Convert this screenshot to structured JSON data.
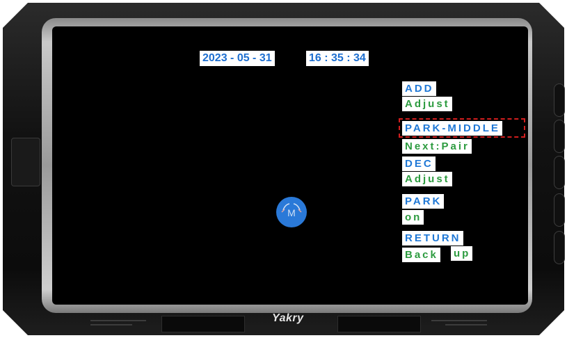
{
  "osd": {
    "date": "2023 - 05 - 31",
    "time": "16 : 35 : 34",
    "menu": [
      {
        "title": "ADD",
        "value": "Adjust"
      },
      {
        "title": "PARK-MIDDLE",
        "value": "Next:Pair",
        "selected": true
      },
      {
        "title": "DEC",
        "value": "Adjust"
      },
      {
        "title": "PARK",
        "value": "on"
      },
      {
        "title": "RETURN",
        "value": "Back",
        "value2": "up"
      }
    ],
    "center_icon": {
      "letter": "M",
      "icon": "camera-mirror-m-icon"
    }
  },
  "device": {
    "brand": "Yakry"
  },
  "colors": {
    "title": "#1f78d6",
    "value": "#2c9b3f",
    "selection": "#d21e1e",
    "icon_bg": "#2a79d8"
  }
}
